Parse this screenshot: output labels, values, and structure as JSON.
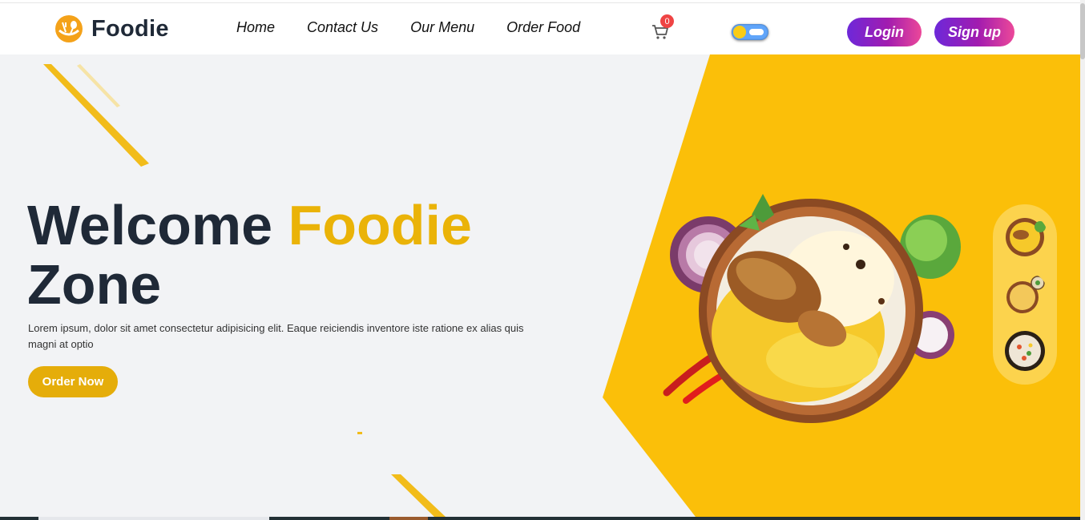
{
  "brand": {
    "name": "Foodie",
    "logo_icon": "fork-spoon-logo-icon"
  },
  "nav": {
    "items": [
      {
        "label": "Home"
      },
      {
        "label": "Contact Us"
      },
      {
        "label": "Our Menu"
      },
      {
        "label": "Order Food"
      }
    ]
  },
  "cart": {
    "icon": "cart-icon",
    "count": "0"
  },
  "theme_toggle": {
    "icon": "sun-cloud-toggle-icon",
    "state": "light"
  },
  "auth": {
    "login_label": "Login",
    "signup_label": "Sign up"
  },
  "hero": {
    "title_part1": "Welcome",
    "title_accent": "Foodie",
    "title_part2": "Zone",
    "description": "Lorem ipsum, dolor sit amet consectetur adipisicing elit. Eaque reiciendis inventore iste ratione ex alias quis magni at optio",
    "cta_label": "Order Now",
    "main_image": "chicken-biryani-plate-image",
    "thumbnails": [
      "biryani-thumb-image",
      "pulao-thumb-image",
      "fried-rice-thumb-image"
    ]
  },
  "colors": {
    "accent": "#eab308",
    "panel_yellow": "#fbbf09",
    "button_gradient_start": "#6d28d9",
    "button_gradient_end": "#ec4899",
    "badge": "#ef4444",
    "heading": "#1f2937"
  }
}
